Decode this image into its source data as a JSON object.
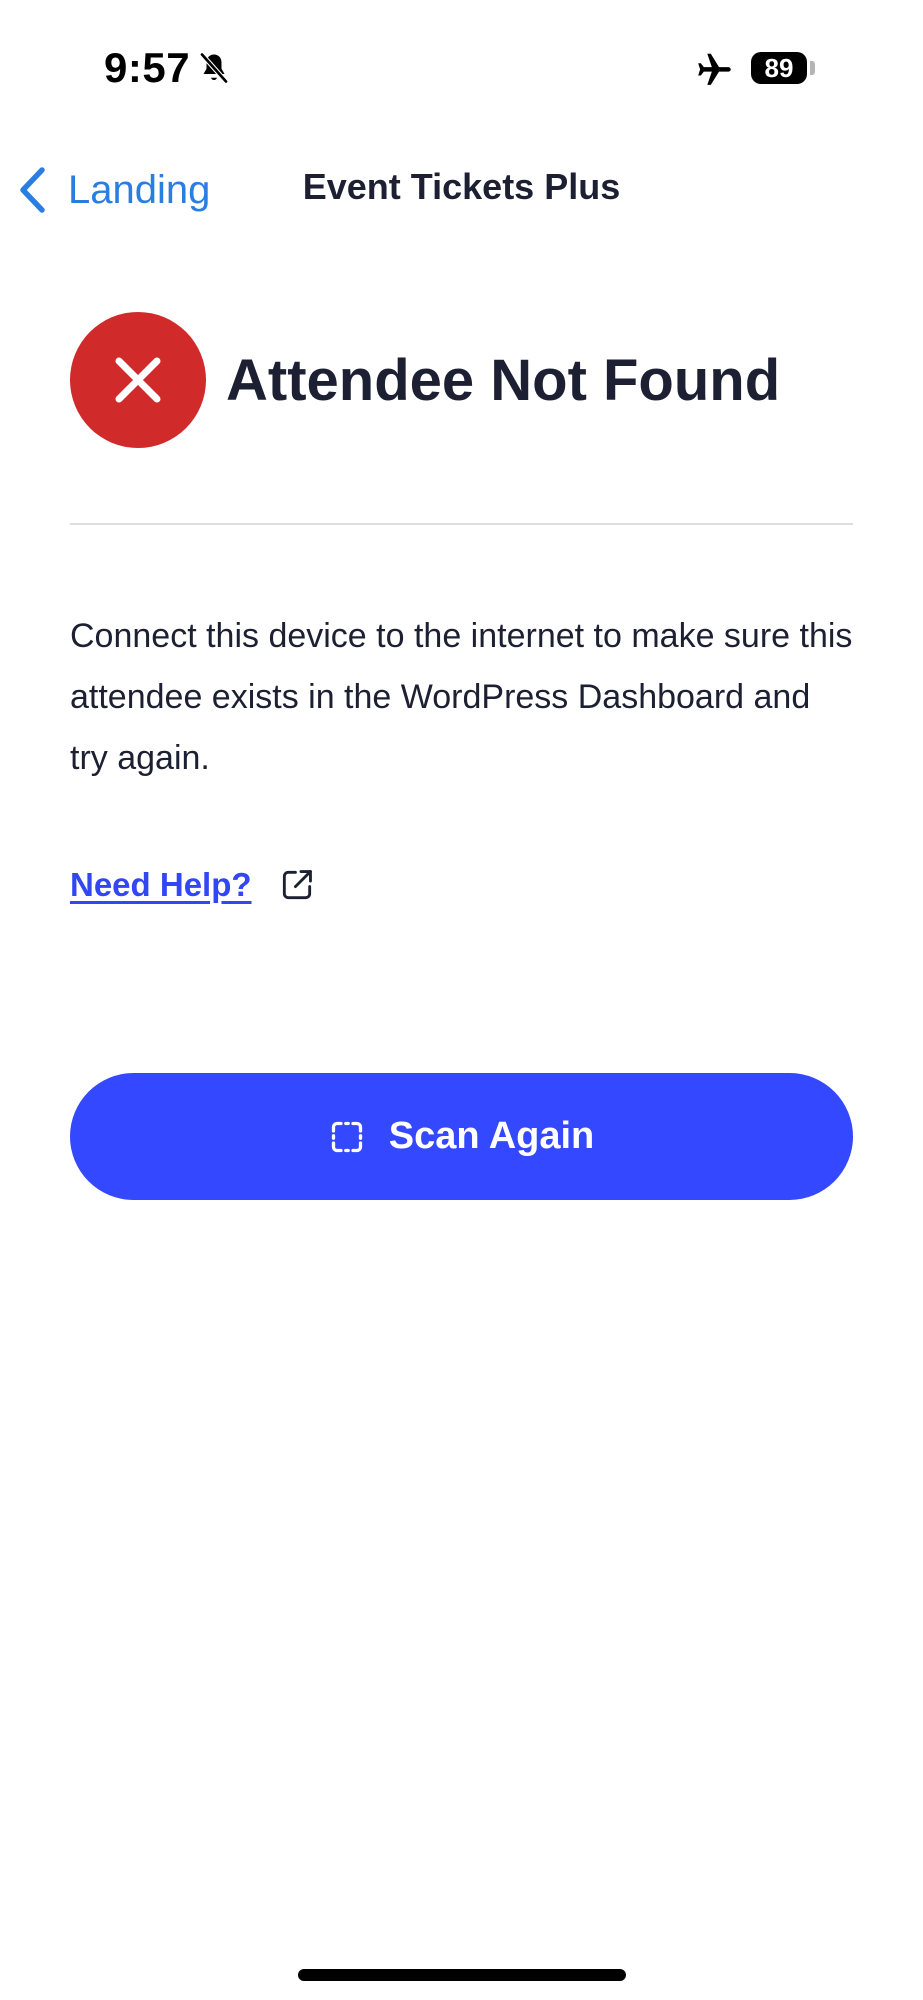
{
  "status_bar": {
    "time": "9:57",
    "battery_level": "89",
    "icons": [
      "bell-slash-icon",
      "airplane-icon",
      "battery-icon"
    ]
  },
  "nav": {
    "back_label": "Landing",
    "title": "Event Tickets Plus"
  },
  "result": {
    "title": "Attendee Not Found",
    "icon": "close-icon",
    "message": "Connect this device to the internet to make sure this attendee exists in the WordPress Dashboard and try again."
  },
  "help": {
    "label": "Need Help?",
    "icon": "external-link-icon"
  },
  "scan_button": {
    "label": "Scan Again",
    "icon": "scan-frame-icon"
  },
  "colors": {
    "accent": "#3448ff",
    "link": "#3346f4",
    "back_link": "#2a7de1",
    "error": "#d12a2a",
    "text": "#1c2032",
    "divider": "#dcdde2"
  }
}
